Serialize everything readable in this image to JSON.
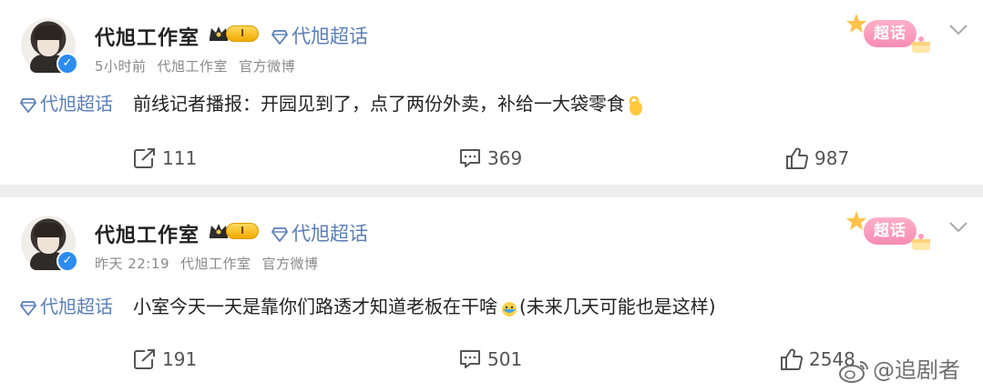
{
  "posts": [
    {
      "author": "代旭工作室",
      "level": "I",
      "topic": "代旭超话",
      "time": "5小时前",
      "source_author": "代旭工作室",
      "source_type": "官方微博",
      "badge": "超话",
      "content_topic": "代旭超话",
      "content_text": "前线记者播报：开园见到了，点了两份外卖，补给一大袋零食",
      "emoji": "ok-hand",
      "shares": "111",
      "comments": "369",
      "likes": "987"
    },
    {
      "author": "代旭工作室",
      "level": "I",
      "topic": "代旭超话",
      "time": "昨天 22:19",
      "source_author": "代旭工作室",
      "source_type": "官方微博",
      "badge": "超话",
      "content_topic": "代旭超话",
      "content_text": "小室今天一天是靠你们路透才知道老板在干啥",
      "content_text_2": "(未来几天可能也是这样)",
      "emoji": "sweat-face",
      "shares": "191",
      "comments": "501",
      "likes": "2548"
    }
  ],
  "watermark": "@追剧者",
  "colors": {
    "topic": "#5b7fb8",
    "meta": "#8a8a8a",
    "badge_pink": "#f68cb3",
    "verify_blue": "#2d8cf0"
  }
}
